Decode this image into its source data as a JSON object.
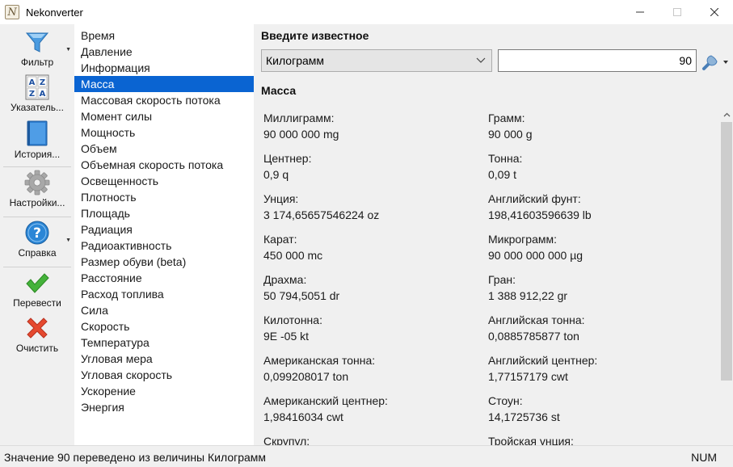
{
  "window": {
    "title": "Nekonverter",
    "icon_letter": "N"
  },
  "toolbar": {
    "filter_label": "Фильтр",
    "index_label": "Указатель...",
    "history_label": "История...",
    "settings_label": "Настройки...",
    "help_label": "Справка",
    "convert_label": "Перевести",
    "clear_label": "Очистить",
    "index_icon_letters": [
      "A",
      "Z",
      "Z",
      "A"
    ],
    "help_icon_glyph": "?"
  },
  "categories": [
    {
      "label": "Время"
    },
    {
      "label": "Давление"
    },
    {
      "label": "Информация"
    },
    {
      "label": "Масса"
    },
    {
      "label": "Массовая скорость потока"
    },
    {
      "label": "Момент силы"
    },
    {
      "label": "Мощность"
    },
    {
      "label": "Объем"
    },
    {
      "label": "Объемная скорость потока"
    },
    {
      "label": "Освещенность"
    },
    {
      "label": "Плотность"
    },
    {
      "label": "Площадь"
    },
    {
      "label": "Радиация"
    },
    {
      "label": "Радиоактивность"
    },
    {
      "label": "Размер обуви (beta)"
    },
    {
      "label": "Расстояние"
    },
    {
      "label": "Расход топлива"
    },
    {
      "label": "Сила"
    },
    {
      "label": "Скорость"
    },
    {
      "label": "Температура"
    },
    {
      "label": "Угловая мера"
    },
    {
      "label": "Угловая скорость"
    },
    {
      "label": "Ускорение"
    },
    {
      "label": "Энергия"
    }
  ],
  "selected_category_index": 3,
  "input": {
    "prompt": "Введите известное",
    "unit": "Килограмм",
    "value": "90"
  },
  "section_title": "Масса",
  "results": [
    {
      "name": "Миллиграмм:",
      "value": "90 000 000 mg"
    },
    {
      "name": "Грамм:",
      "value": "90 000 g"
    },
    {
      "name": "Центнер:",
      "value": "0,9 q"
    },
    {
      "name": "Тонна:",
      "value": "0,09 t"
    },
    {
      "name": "Унция:",
      "value": "3 174,65657546224 oz"
    },
    {
      "name": "Английский фунт:",
      "value": "198,41603596639 lb"
    },
    {
      "name": "Карат:",
      "value": "450 000 mc"
    },
    {
      "name": "Микрограмм:",
      "value": "90 000 000 000 µg"
    },
    {
      "name": "Драхма:",
      "value": "50 794,5051 dr"
    },
    {
      "name": "Гран:",
      "value": "1 388 912,22 gr"
    },
    {
      "name": "Килотонна:",
      "value": "9E -05 kt"
    },
    {
      "name": "Английская тонна:",
      "value": "0,0885785877 ton"
    },
    {
      "name": "Американская тонна:",
      "value": "0,099208017 ton"
    },
    {
      "name": "Английский центнер:",
      "value": "1,77157179 cwt"
    },
    {
      "name": "Американский центнер:",
      "value": "1,98416034 cwt"
    },
    {
      "name": "Стоун:",
      "value": "14,1725736 st"
    },
    {
      "name": "Скрупул:",
      "value": ""
    },
    {
      "name": "Тройская унция:",
      "value": ""
    }
  ],
  "status": {
    "message": "Значение 90 переведено из величины Килограмм",
    "num_indicator": "NUM"
  },
  "colors": {
    "selection": "#0a64d2",
    "panel_bg": "#f0f0f0",
    "filter_icon": "#3d8fd8",
    "check_icon": "#3aa82b",
    "clear_icon": "#e0472f"
  }
}
